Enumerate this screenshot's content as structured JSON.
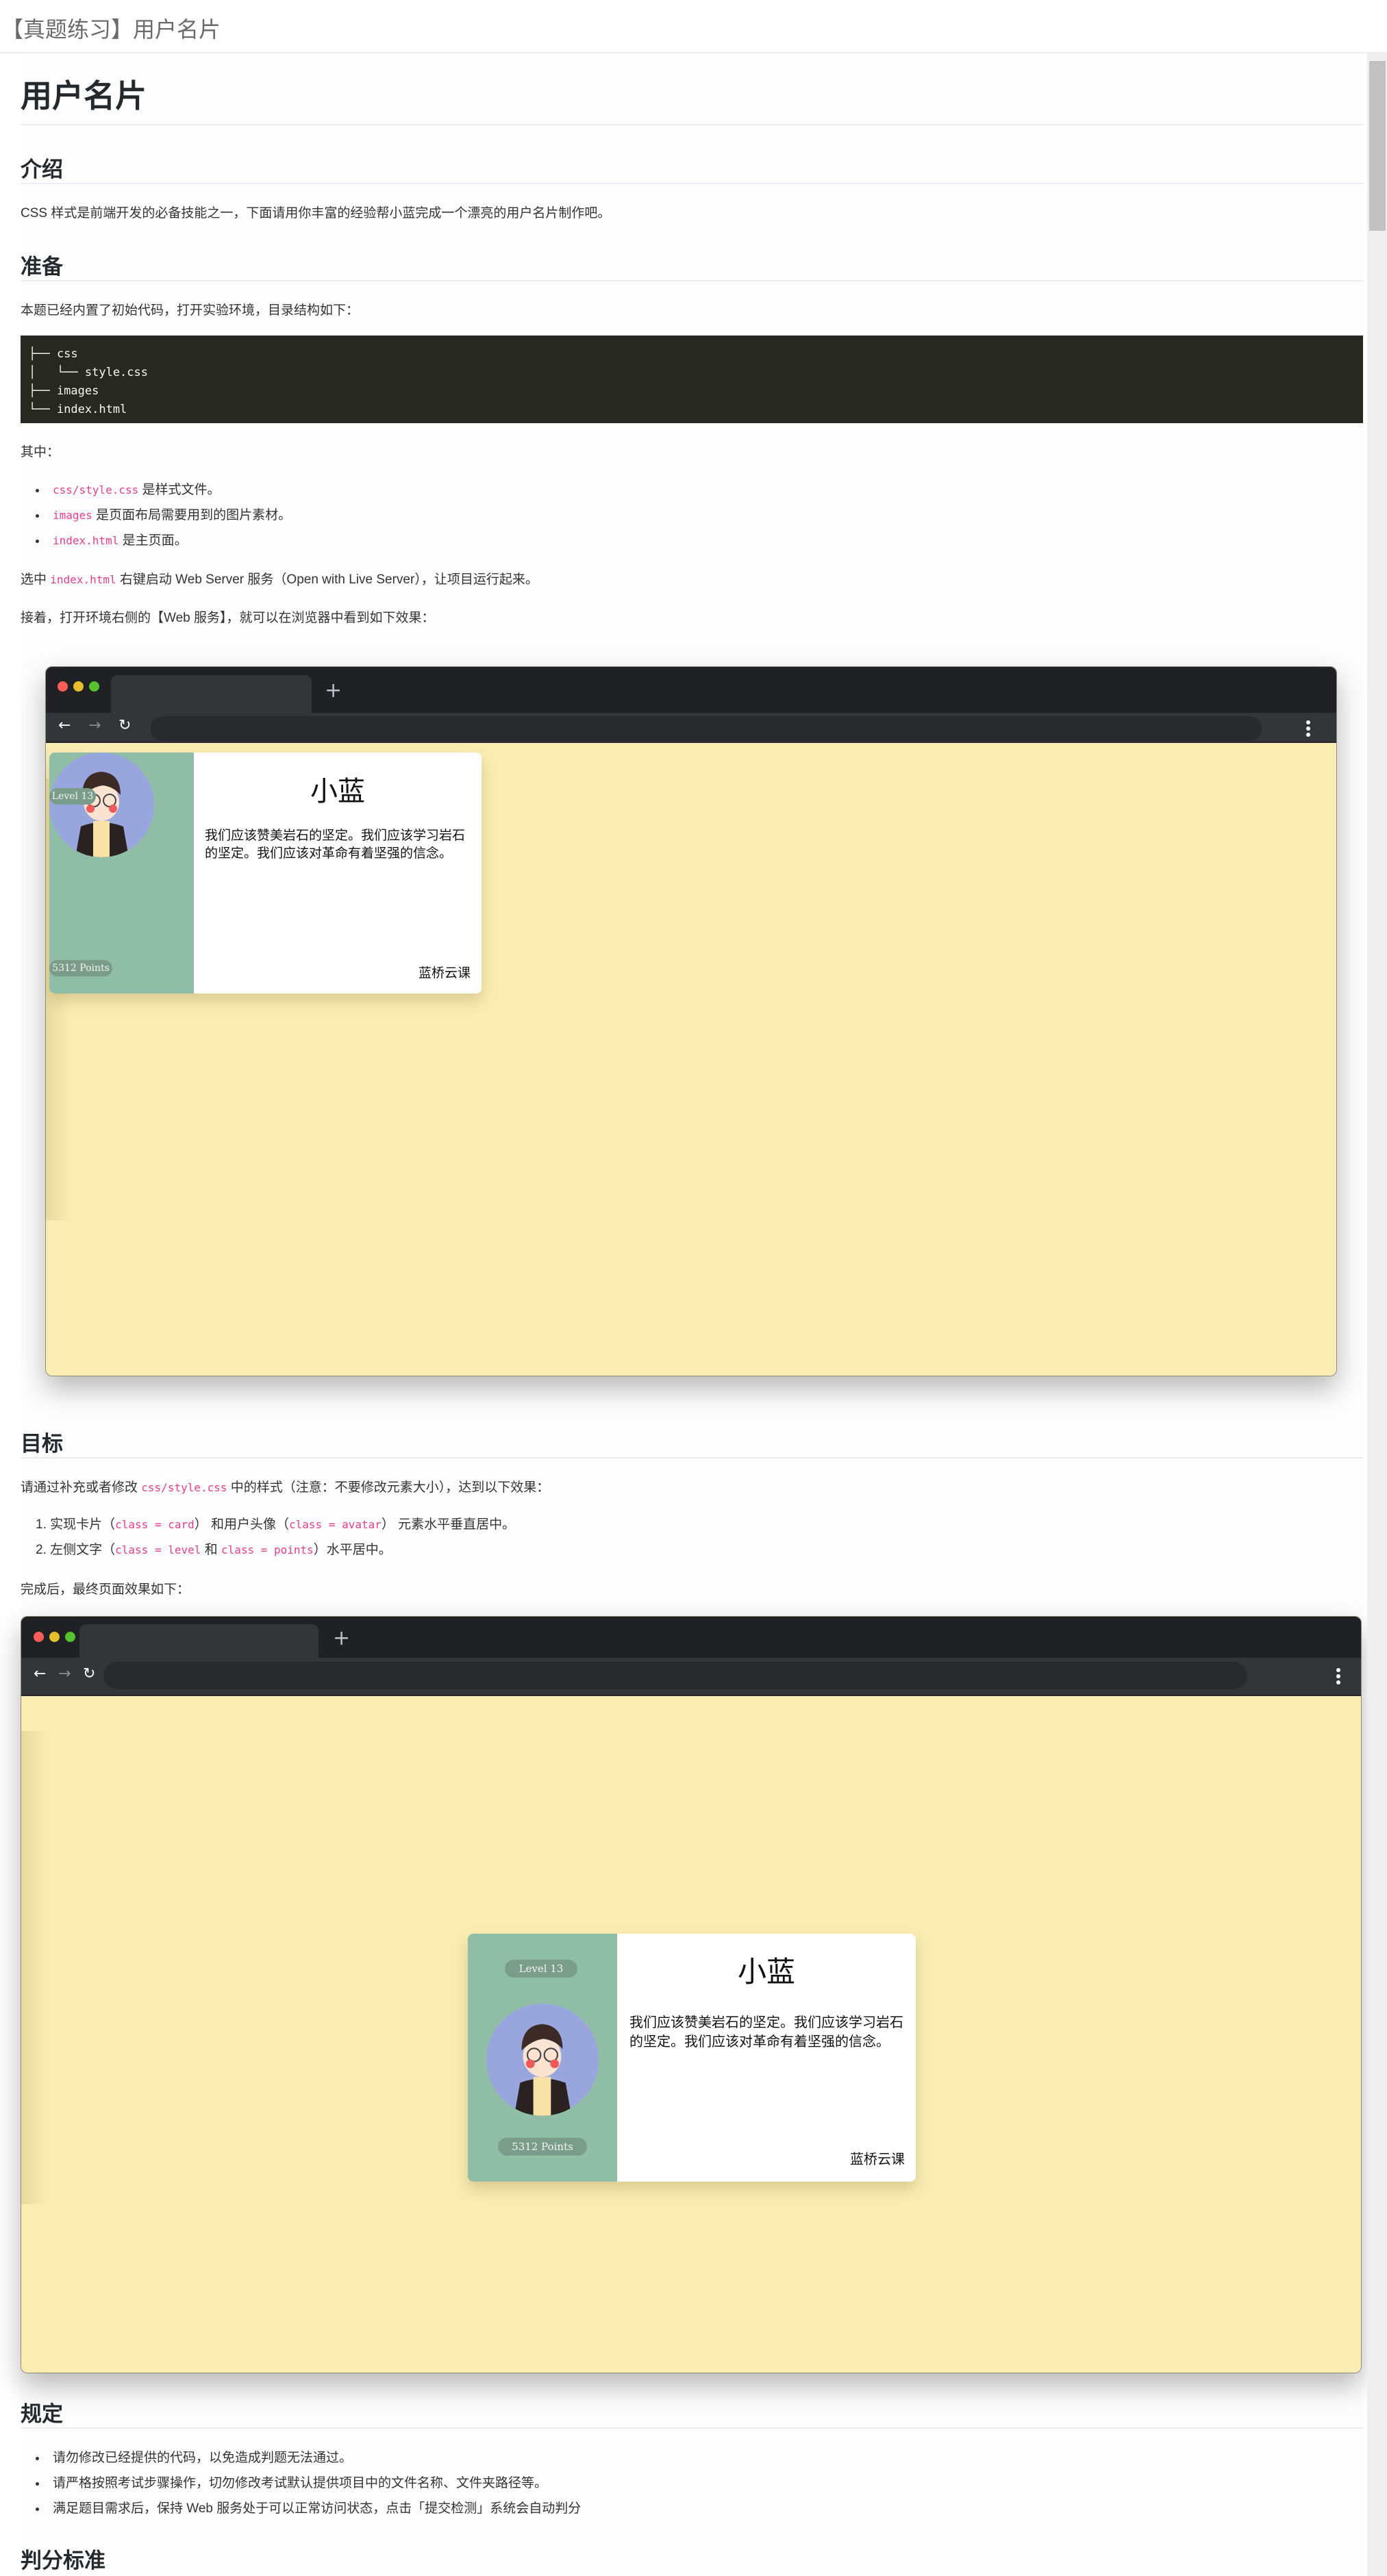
{
  "header": {
    "title": "【真题练习】用户名片"
  },
  "page": {
    "h1": "用户名片",
    "intro": {
      "heading": "介绍",
      "text": "CSS 样式是前端开发的必备技能之一，下面请用你丰富的经验帮小蓝完成一个漂亮的用户名片制作吧。"
    },
    "prep": {
      "heading": "准备",
      "text": "本题已经内置了初始代码，打开实验环境，目录结构如下：",
      "tree": "├── css\n│   └── style.css\n├── images\n└── index.html",
      "among": "其中：",
      "items": [
        {
          "code": "css/style.css",
          "text": " 是样式文件。"
        },
        {
          "code": "images",
          "text": " 是页面布局需要用到的图片素材。"
        },
        {
          "code": "index.html",
          "text": " 是主页面。"
        }
      ],
      "run_prefix": "选中 ",
      "run_code": "index.html",
      "run_suffix": " 右键启动 Web Server 服务（Open with Live Server），让项目运行起来。",
      "next": "接着，打开环境右侧的【Web 服务】，就可以在浏览器中看到如下效果："
    },
    "goal": {
      "heading": "目标",
      "text_prefix": "请通过补充或者修改 ",
      "text_code": "css/style.css",
      "text_suffix": " 中的样式（注意：不要修改元素大小），达到以下效果：",
      "items": [
        {
          "a": "实现卡片（",
          "c1": "class = card",
          "b": "） 和用户头像（",
          "c2": "class = avatar",
          "d": "） 元素水平垂直居中。"
        },
        {
          "a": "左侧文字（",
          "c1": "class = level",
          "b": " 和 ",
          "c2": "class = points",
          "d": "）水平居中。"
        }
      ],
      "after": "完成后，最终页面效果如下："
    },
    "rules": {
      "heading": "规定",
      "items": [
        "请勿修改已经提供的代码，以免造成判题无法通过。",
        "请严格按照考试步骤操作，切勿修改考试默认提供项目中的文件名称、文件夹路径等。",
        "满足题目需求后，保持 Web 服务处于可以正常访问状态，点击「提交检测」系统会自动判分"
      ]
    },
    "scoring": {
      "heading": "判分标准"
    }
  },
  "browser": {
    "dots": [
      "#ff5f57",
      "#e6c02a",
      "#55c22e"
    ],
    "plus": "+",
    "back": "←",
    "forward": "→",
    "reload": "↻",
    "viewport_bg": "#f9edb3"
  },
  "card": {
    "level": "Level 13",
    "points": "5312 Points",
    "name": "小蓝",
    "desc": "我们应该赞美岩石的坚定。我们应该学习岩石的坚定。我们应该对革命有着坚强的信念。",
    "brand": "蓝桥云课",
    "left_bg": "#90bda6",
    "avatar_bg": "#98a6dd"
  }
}
